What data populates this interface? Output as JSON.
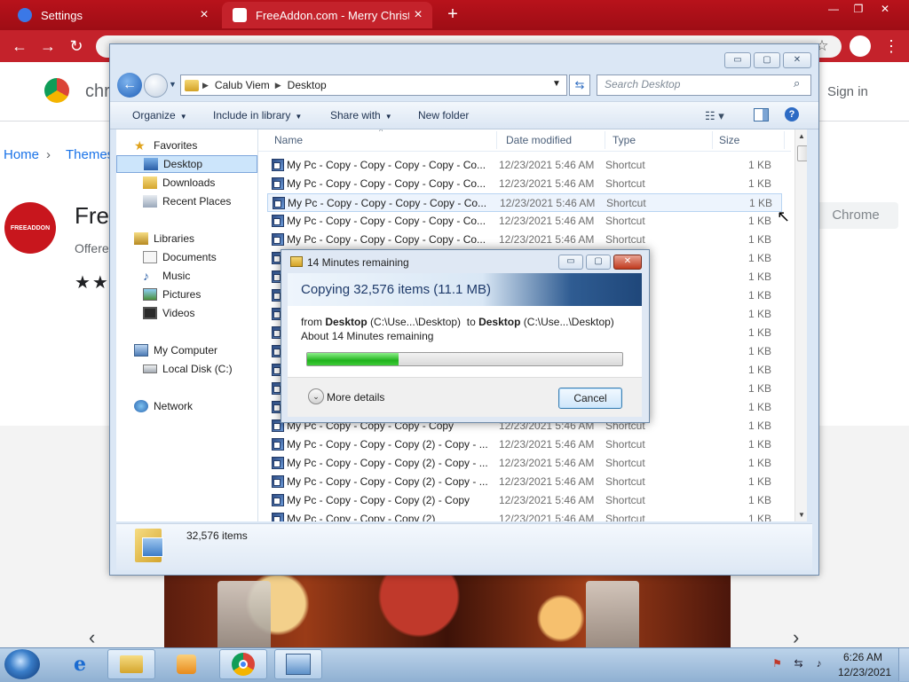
{
  "browser": {
    "tabs": [
      {
        "title": "Settings",
        "close": "×"
      },
      {
        "title": "FreeAddon.com - Merry Christmas",
        "close": "×"
      }
    ],
    "new_tab": "+",
    "window_buttons": {
      "minimize": "—",
      "maximize": "❐",
      "close": "✕"
    },
    "nav": {
      "back": "←",
      "forward": "→",
      "reload": "↻"
    },
    "star": "☆",
    "menu": "⋮"
  },
  "webpage": {
    "store_name": "chr",
    "sign_in": "Sign in",
    "breadcrumb": {
      "home": "Home",
      "sep": "›",
      "themes": "Themes"
    },
    "extension": {
      "logo_text": "FREEADDON",
      "title": "Fre",
      "offered": "Offere",
      "stars": "★★",
      "add_button": "Chrome"
    },
    "carousel": {
      "prev": "‹",
      "next": "›"
    }
  },
  "explorer": {
    "caption": {
      "minimize": "▭",
      "maximize": "▢",
      "close": "✕"
    },
    "nav_buttons": {
      "back": "←",
      "history": "▼"
    },
    "address": {
      "segments": [
        "Calub Viem",
        "Desktop"
      ],
      "separator": "▶",
      "dropdown": "▼"
    },
    "refresh": "⇆",
    "search_placeholder": "Search Desktop",
    "search_icon": "⌕",
    "commands": {
      "organize": "Organize",
      "include": "Include in library",
      "share": "Share with",
      "new_folder": "New folder",
      "arrow": "▼"
    },
    "view_icon": "☷ ▾",
    "help": "?",
    "nav_pane": {
      "favorites": "Favorites",
      "desktop": "Desktop",
      "downloads": "Downloads",
      "recent": "Recent Places",
      "libraries": "Libraries",
      "documents": "Documents",
      "music": "Music",
      "pictures": "Pictures",
      "videos": "Videos",
      "computer": "My Computer",
      "local_disk": "Local Disk (C:)",
      "network": "Network"
    },
    "columns": {
      "name": "Name",
      "date": "Date modified",
      "type": "Type",
      "size": "Size",
      "sort": "^"
    },
    "rows": [
      {
        "name": "My Pc - Copy - Copy - Copy - Copy - Co...",
        "date": "12/23/2021 5:46 AM",
        "type": "Shortcut",
        "size": "1 KB"
      },
      {
        "name": "My Pc - Copy - Copy - Copy - Copy - Co...",
        "date": "12/23/2021 5:46 AM",
        "type": "Shortcut",
        "size": "1 KB"
      },
      {
        "name": "My Pc - Copy - Copy - Copy - Copy - Co...",
        "date": "12/23/2021 5:46 AM",
        "type": "Shortcut",
        "size": "1 KB"
      },
      {
        "name": "My Pc - Copy - Copy - Copy - Copy - Co...",
        "date": "12/23/2021 5:46 AM",
        "type": "Shortcut",
        "size": "1 KB"
      },
      {
        "name": "My Pc - Copy - Copy - Copy - Copy - Co...",
        "date": "12/23/2021 5:46 AM",
        "type": "Shortcut",
        "size": "1 KB"
      },
      {
        "name": "",
        "date": "",
        "type": "",
        "size": "1 KB"
      },
      {
        "name": "",
        "date": "",
        "type": "",
        "size": "1 KB"
      },
      {
        "name": "",
        "date": "",
        "type": "",
        "size": "1 KB"
      },
      {
        "name": "",
        "date": "",
        "type": "",
        "size": "1 KB"
      },
      {
        "name": "",
        "date": "",
        "type": "",
        "size": "1 KB"
      },
      {
        "name": "",
        "date": "",
        "type": "",
        "size": "1 KB"
      },
      {
        "name": "",
        "date": "",
        "type": "",
        "size": "1 KB"
      },
      {
        "name": "",
        "date": "",
        "type": "",
        "size": "1 KB"
      },
      {
        "name": "",
        "date": "",
        "type": "",
        "size": "1 KB"
      },
      {
        "name": "My Pc - Copy - Copy - Copy - Copy",
        "date": "12/23/2021 5:46 AM",
        "type": "Shortcut",
        "size": "1 KB"
      },
      {
        "name": "My Pc - Copy - Copy - Copy (2) - Copy - ...",
        "date": "12/23/2021 5:46 AM",
        "type": "Shortcut",
        "size": "1 KB"
      },
      {
        "name": "My Pc - Copy - Copy - Copy (2) - Copy - ...",
        "date": "12/23/2021 5:46 AM",
        "type": "Shortcut",
        "size": "1 KB"
      },
      {
        "name": "My Pc - Copy - Copy - Copy (2) - Copy - ...",
        "date": "12/23/2021 5:46 AM",
        "type": "Shortcut",
        "size": "1 KB"
      },
      {
        "name": "My Pc - Copy - Copy - Copy (2) - Copy",
        "date": "12/23/2021 5:46 AM",
        "type": "Shortcut",
        "size": "1 KB"
      },
      {
        "name": "My Pc - Copy - Copy - Copy (2)",
        "date": "12/23/2021 5:46 AM",
        "type": "Shortcut",
        "size": "1 KB"
      }
    ],
    "hovered_row_index": 2,
    "scroll": {
      "up": "▲",
      "down": "▼"
    },
    "item_count": "32,576 items"
  },
  "copy_dialog": {
    "title": "14 Minutes remaining",
    "buttons": {
      "minimize": "▭",
      "maximize": "▢",
      "close": "✕"
    },
    "heading": "Copying 32,576 items (11.1 MB)",
    "from_label": "from",
    "from_name": "Desktop",
    "from_path": "(C:\\Use...\\Desktop)",
    "to_label": "to",
    "to_name": "Desktop",
    "to_path": "(C:\\Use...\\Desktop)",
    "remaining": "About 14 Minutes remaining",
    "progress_fraction": 0.29,
    "more_icon": "⌄",
    "more_details": "More details",
    "cancel": "Cancel"
  },
  "taskbar": {
    "ie_label": "e",
    "tray_icons": [
      "⚑",
      "⇆",
      "♪"
    ],
    "time": "6:26 AM",
    "date": "12/23/2021"
  },
  "cursor": "↖"
}
